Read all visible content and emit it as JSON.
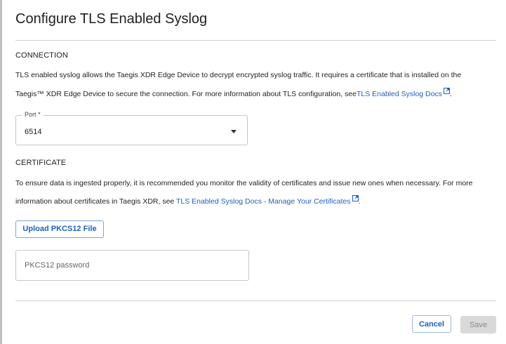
{
  "dialog": {
    "title": "Configure TLS Enabled Syslog"
  },
  "connection": {
    "heading": "CONNECTION",
    "description_line1": "TLS enabled syslog allows the Taegis XDR Edge Device to decrypt encrypted syslog traffic. It requires a certificate that is installed on the",
    "description_line2": "Taegis™ XDR Edge Device to secure the connection. For more information about TLS configuration, see",
    "docs_link": "TLS Enabled Syslog Docs",
    "description_end": ".",
    "port_label": "Port *",
    "port_value": "6514"
  },
  "certificate": {
    "heading": "CERTIFICATE",
    "description_line1": "To ensure data is ingested properly, it is recommended you monitor the validity of certificates and issue new ones when necessary. For more",
    "description_line2": "information about certificates in Taegis XDR, see ",
    "docs_link": "TLS Enabled Syslog Docs - Manage Your Certificates",
    "description_end": ".",
    "upload_label": "Upload PKCS12 File",
    "password_placeholder": "PKCS12 password"
  },
  "footer": {
    "cancel_label": "Cancel",
    "save_label": "Save"
  },
  "colors": {
    "link": "#1f5fbf",
    "disabled_button": "#d9d9d9"
  },
  "icons": {
    "external_link": "external-link-icon",
    "dropdown": "chevron-down-icon"
  }
}
